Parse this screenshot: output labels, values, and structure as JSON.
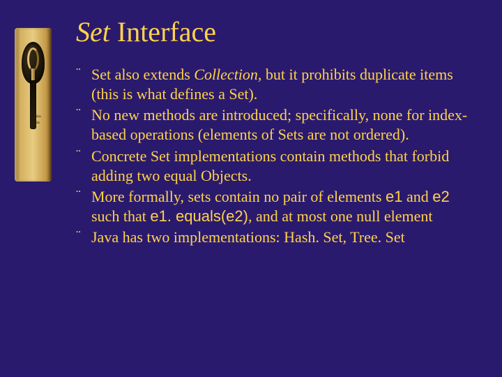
{
  "title": {
    "italic_part": "Set",
    "rest": " Interface"
  },
  "bullets": {
    "b0": {
      "pre": "Set also extends ",
      "em": "Collection",
      "post": ", but it prohibits duplicate items (this is what defines a Set)."
    },
    "b1": "No new methods are introduced; specifically, none for index-based operations (elements of Sets are not ordered).",
    "b2": "Concrete Set implementations contain methods that forbid adding two equal Objects.",
    "b3": {
      "t0": "More formally, sets contain no pair of elements ",
      "c0": "e1",
      "t1": " and ",
      "c1": "e2",
      "t2": " such that ",
      "c2": "e1. equals(e2)",
      "t3": ", and at most one null element"
    },
    "b4": "Java has two implementations: Hash. Set, Tree. Set"
  }
}
